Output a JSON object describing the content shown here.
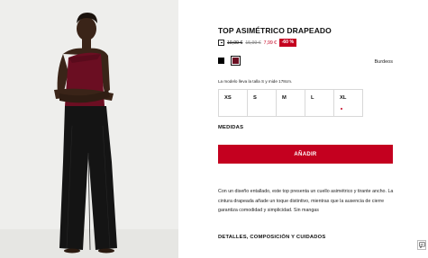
{
  "product": {
    "title": "TOP ASIMÉTRICO DRAPEADO",
    "price_original": "19,99 €",
    "price_previous": "15,99 €",
    "price_current": "7,99 €",
    "discount_badge": "-60 %",
    "color_name": "Burdeos",
    "model_note": "La modelo lleva la talla S y mide 178cm.",
    "sizes": [
      {
        "label": "XS",
        "low_stock": false
      },
      {
        "label": "S",
        "low_stock": false
      },
      {
        "label": "M",
        "low_stock": false
      },
      {
        "label": "L",
        "low_stock": false
      },
      {
        "label": "XL",
        "low_stock": true
      }
    ],
    "measurements_link": "MEDIDAS",
    "add_button": "AÑADIR",
    "description": "Con un diseño entallado, este top presenta un cuello asimétrico y tirante ancho. La cintura drapeada añade un toque distintivo, mientras que la ausencia de cierre garantiza comodidad y simplicidad. Sin mangas",
    "details_heading": "DETALLES, COMPOSICIÓN Y CUIDADOS"
  },
  "swatches": [
    {
      "name": "black",
      "color": "#000000"
    },
    {
      "name": "burdeos",
      "color": "#6b0e22"
    }
  ],
  "colors": {
    "accent": "#c4001f",
    "border": "#d8d8d8"
  },
  "icons": {
    "price_info": "price-tag-icon",
    "chat": "chat-icon"
  }
}
